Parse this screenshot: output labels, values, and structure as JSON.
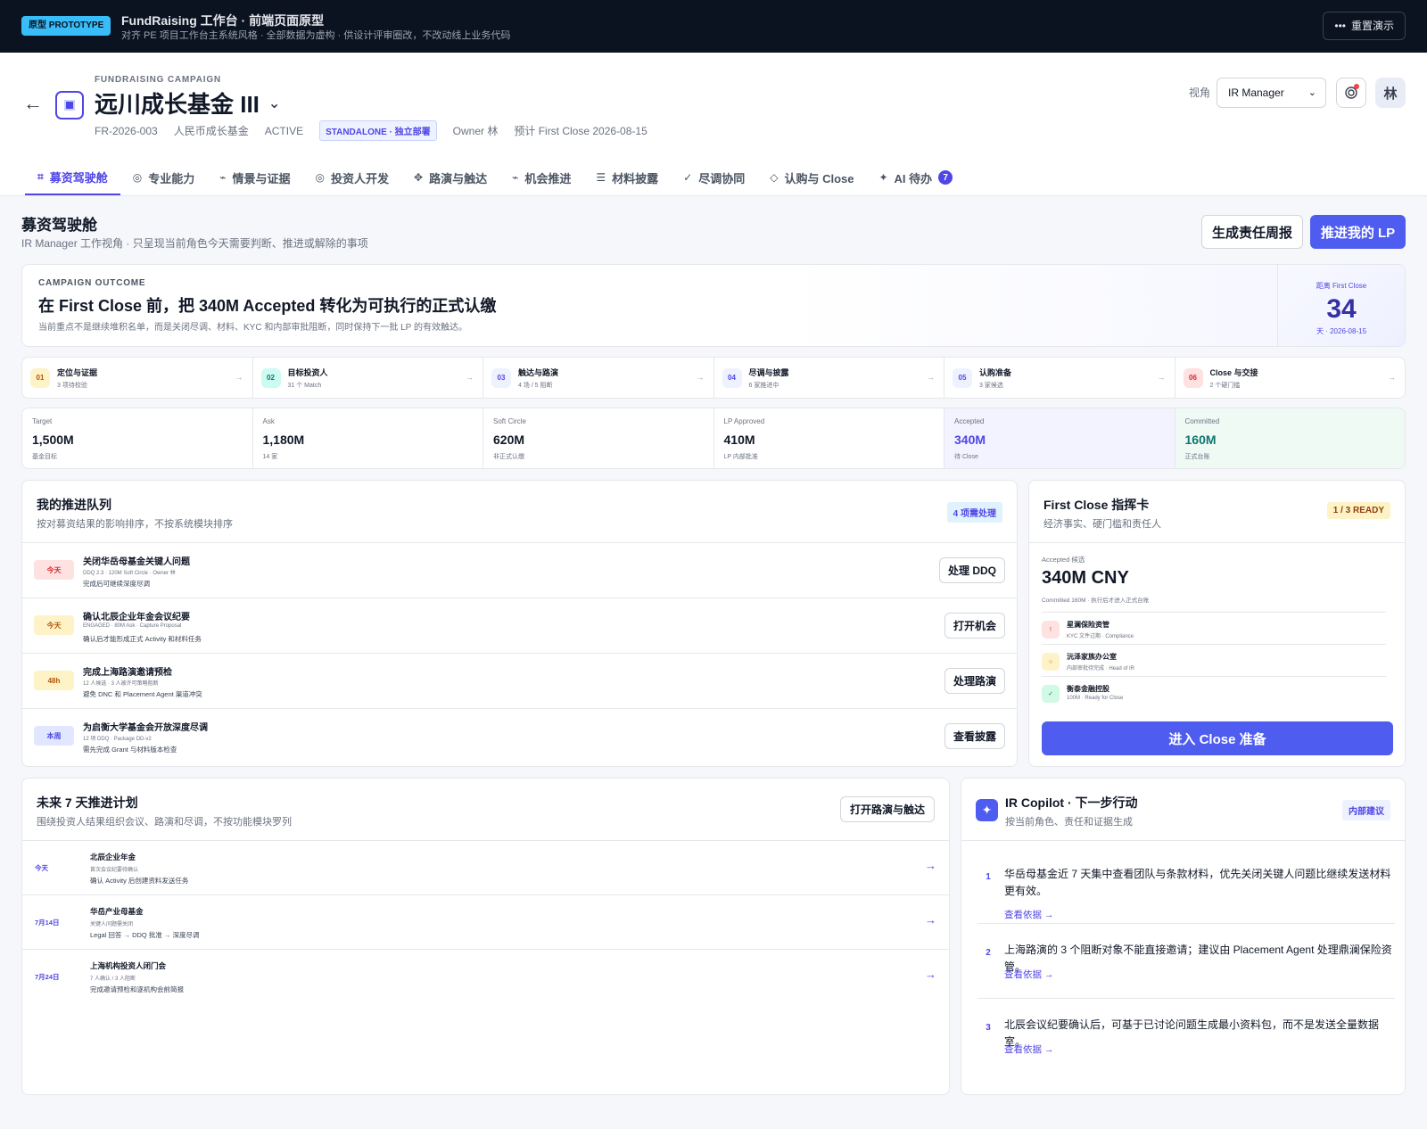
{
  "topbar": {
    "badge": "原型 PROTOTYPE",
    "title": "FundRaising 工作台 · 前端页面原型",
    "subtitle": "对齐 PE 项目工作台主系统风格 · 全部数据为虚构 · 供设计评审圈改，不改动线上业务代码",
    "reset_icon": "•••",
    "reset_label": "重置演示"
  },
  "header": {
    "back": "←",
    "eyebrow": "FUNDRAISING CAMPAIGN",
    "title": "远川成长基金 III",
    "title_caret": "⌄",
    "code": "FR-2026-003",
    "fund_type": "人民币成长基金",
    "status": "ACTIVE",
    "deployment_badge": "STANDALONE · 独立部署",
    "owner": "Owner 林",
    "first_close": "预计 First Close 2026-08-15",
    "view_label": "视角",
    "view_select": "IR Manager",
    "avatar": "林"
  },
  "tabs": [
    {
      "icon": "⌗",
      "label": "募资驾驶舱"
    },
    {
      "icon": "◎",
      "label": "专业能力"
    },
    {
      "icon": "⌁",
      "label": "情景与证据"
    },
    {
      "icon": "◎",
      "label": "投资人开发"
    },
    {
      "icon": "✥",
      "label": "路演与触达"
    },
    {
      "icon": "⌁",
      "label": "机会推进"
    },
    {
      "icon": "☰",
      "label": "材料披露"
    },
    {
      "icon": "✓",
      "label": "尽调协同"
    },
    {
      "icon": "◇",
      "label": "认购与 Close"
    },
    {
      "icon": "✦",
      "label": "AI 待办",
      "count": "7"
    }
  ],
  "page": {
    "title": "募资驾驶舱",
    "subtitle": "IR Manager 工作视角 · 只呈现当前角色今天需要判断、推进或解除的事项",
    "report_button": "生成责任周报",
    "push_button": "推进我的 LP"
  },
  "outcome": {
    "eyebrow": "CAMPAIGN OUTCOME",
    "title": "在 First Close 前，把 340M Accepted 转化为可执行的正式认缴",
    "subtitle": "当前重点不是继续堆积名单，而是关闭尽调、材料、KYC 和内部审批阻断，同时保持下一批 LP 的有效触达。",
    "countdown_label": "距离 First Close",
    "countdown_days": "34",
    "countdown_date": "天 · 2026-08-15"
  },
  "stages": [
    {
      "num": "01",
      "title": "定位与证据",
      "sub": "3 项待校验",
      "color": "#b45309",
      "bg": "#fef3c7"
    },
    {
      "num": "02",
      "title": "目标投资人",
      "sub": "31 个 Match",
      "color": "#0f766e",
      "bg": "#ccfbf1"
    },
    {
      "num": "03",
      "title": "触达与路演",
      "sub": "4 场 / 5 阻断",
      "color": "#4f46e5",
      "bg": "#eef2ff"
    },
    {
      "num": "04",
      "title": "尽调与披露",
      "sub": "6 家推进中",
      "color": "#4f46e5",
      "bg": "#eef2ff"
    },
    {
      "num": "05",
      "title": "认购准备",
      "sub": "3 家候选",
      "color": "#4f46e5",
      "bg": "#eef2ff"
    },
    {
      "num": "06",
      "title": "Close 与交接",
      "sub": "2 个硬门槛",
      "color": "#dc2626",
      "bg": "#fee2e2"
    }
  ],
  "stage_arrow": "→",
  "metrics": [
    {
      "label": "Target",
      "value": "1,500M",
      "sub": "基金目标",
      "color": "#111827",
      "bg": "#ffffff"
    },
    {
      "label": "Ask",
      "value": "1,180M",
      "sub": "14 家",
      "color": "#111827",
      "bg": "#ffffff"
    },
    {
      "label": "Soft Circle",
      "value": "620M",
      "sub": "非正式认缴",
      "color": "#111827",
      "bg": "#ffffff"
    },
    {
      "label": "LP Approved",
      "value": "410M",
      "sub": "LP 内部批准",
      "color": "#111827",
      "bg": "#ffffff"
    },
    {
      "label": "Accepted",
      "value": "340M",
      "sub": "待 Close",
      "color": "#4f46e5",
      "bg": "#f3f2ff"
    },
    {
      "label": "Committed",
      "value": "160M",
      "sub": "正式台账",
      "color": "#0f766e",
      "bg": "#effaf5"
    }
  ],
  "queue": {
    "title": "我的推进队列",
    "subtitle": "按对募资结果的影响排序，不按系统模块排序",
    "badge": "4 项需处理",
    "items": [
      {
        "pill": "今天",
        "pill_color": "#dc2626",
        "pill_bg": "#fee2e2",
        "title": "关闭华岳母基金关键人问题",
        "meta": "DDQ 2.3 · 120M Soft Circle · Owner 林",
        "desc": "完成后可继续深度尽调",
        "button": "处理 DDQ"
      },
      {
        "pill": "今天",
        "pill_color": "#b45309",
        "pill_bg": "#fef3c7",
        "title": "确认北辰企业年金会议纪要",
        "meta": "ENGAGED · 80M Ask · Capture Proposal",
        "desc": "确认后才能形成正式 Activity 和材料任务",
        "button": "打开机会"
      },
      {
        "pill": "48h",
        "pill_color": "#b45309",
        "pill_bg": "#fef3c7",
        "title": "完成上海路演邀请预检",
        "meta": "12 人候选 · 3 人被许可策略阻断",
        "desc": "避免 DNC 和 Placement Agent 渠道冲突",
        "button": "处理路演"
      },
      {
        "pill": "本周",
        "pill_color": "#4f46e5",
        "pill_bg": "#e0e7ff",
        "title": "为启衡大学基金会开放深度尽调",
        "meta": "12 项 DDQ · Package DD-v2",
        "desc": "需先完成 Grant 与材料版本检查",
        "button": "查看披露"
      }
    ]
  },
  "first_close": {
    "title": "First Close 指挥卡",
    "subtitle": "经济事实、硬门槛和责任人",
    "badge": "1 / 3 READY",
    "amount_label": "Accepted 候选",
    "amount": "340M CNY",
    "amount_note": "Committed 160M · 执行后才进入正式台账",
    "items": [
      {
        "icon": "!",
        "icon_color": "#dc2626",
        "icon_bg": "#fee2e2",
        "title": "星澜保险资管",
        "sub": "KYC 文件过期 · Compliance"
      },
      {
        "icon": "○",
        "icon_color": "#b45309",
        "icon_bg": "#fef3c7",
        "title": "沅泽家族办公室",
        "sub": "内部审批待完成 · Head of IR"
      },
      {
        "icon": "✓",
        "icon_color": "#0f766e",
        "icon_bg": "#d1fae5",
        "title": "衡泰金融控股",
        "sub": "100M · Ready for Close"
      }
    ],
    "button": "进入 Close 准备"
  },
  "plan": {
    "title": "未来 7 天推进计划",
    "subtitle": "围绕投资人结果组织会议、路演和尽调，不按功能模块罗列",
    "button": "打开路演与触达",
    "items": [
      {
        "date": "今天",
        "title": "北辰企业年金",
        "meta": "首次会议纪要待确认",
        "desc": "确认 Activity 后创建资料发送任务"
      },
      {
        "date": "7月14日",
        "title": "华岳产业母基金",
        "meta": "关键人问题需关闭",
        "desc": "Legal 回答 → DDQ 批准 → 深度尽调"
      },
      {
        "date": "7月24日",
        "title": "上海机构投资人闭门会",
        "meta": "7 人确认 / 3 人阻断",
        "desc": "完成邀请预检和逐机构会前简报"
      }
    ],
    "arrow": "→"
  },
  "copilot": {
    "icon": "✦",
    "title": "IR Copilot · 下一步行动",
    "subtitle": "按当前角色、责任和证据生成",
    "badge": "内部建议",
    "items": [
      {
        "num": "1",
        "text": "华岳母基金近 7 天集中查看团队与条款材料，优先关闭关键人问题比继续发送材料更有效。",
        "link": "查看依据 →"
      },
      {
        "num": "2",
        "text": "上海路演的 3 个阻断对象不能直接邀请；建议由 Placement Agent 处理鼎澜保险资管。",
        "link": "查看依据 →"
      },
      {
        "num": "3",
        "text": "北辰会议纪要确认后，可基于已讨论问题生成最小资料包，而不是发送全量数据室。",
        "link": "查看依据 →"
      }
    ]
  }
}
